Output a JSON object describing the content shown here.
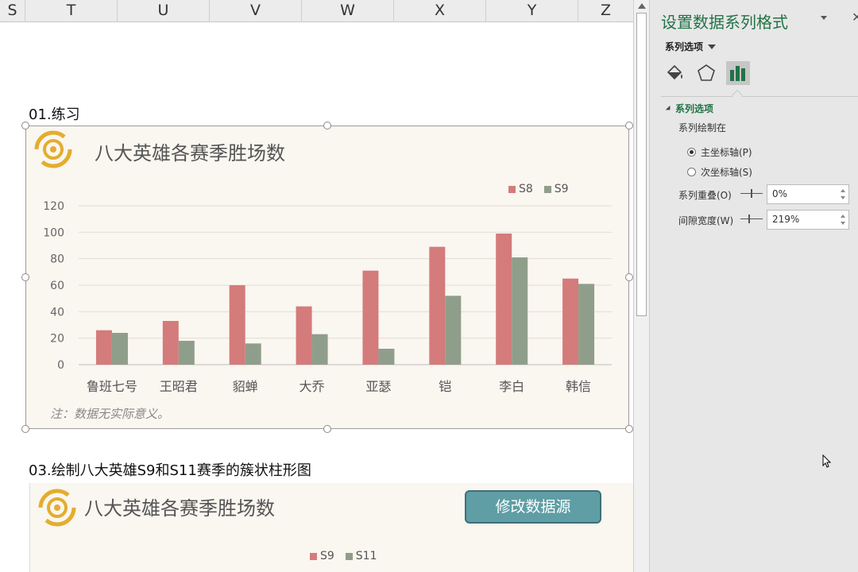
{
  "columns": [
    "S",
    "T",
    "U",
    "V",
    "W",
    "X",
    "Y",
    "Z"
  ],
  "section1_title": "01.练习",
  "section3_title": "03.绘制八大英雄S9和S11赛季的簇状柱形图",
  "chart1": {
    "title": "八大英雄各赛季胜场数",
    "note": "注：数据无实际意义。"
  },
  "chart2": {
    "title": "八大英雄各赛季胜场数",
    "button_label": "修改数据源",
    "legend": [
      "S9",
      "S11"
    ]
  },
  "chart_data": {
    "type": "bar",
    "title": "八大英雄各赛季胜场数",
    "categories": [
      "鲁班七号",
      "王昭君",
      "貂蝉",
      "大乔",
      "亚瑟",
      "铠",
      "李白",
      "韩信"
    ],
    "series": [
      {
        "name": "S8",
        "values": [
          26,
          33,
          60,
          44,
          71,
          89,
          99,
          65
        ],
        "color": "#d47b7b"
      },
      {
        "name": "S9",
        "values": [
          24,
          18,
          16,
          23,
          12,
          52,
          81,
          61
        ],
        "color": "#8f9e8a"
      }
    ],
    "yticks": [
      "0",
      "20",
      "40",
      "60",
      "80",
      "100",
      "120"
    ],
    "ylim": [
      0,
      120
    ],
    "grid": true,
    "legend_position": "top-right",
    "xlabel": "",
    "ylabel": ""
  },
  "pane": {
    "title": "设置数据系列格式",
    "options_dropdown": "系列选项",
    "section_label": "系列选项",
    "plot_on_label": "系列绘制在",
    "radio_primary": "主坐标轴(P)",
    "radio_secondary": "次坐标轴(S)",
    "overlap_label": "系列重叠(O)",
    "overlap_value": "0%",
    "gap_label": "间隙宽度(W)",
    "gap_value": "219%",
    "icons": [
      "fill-line-icon",
      "effects-icon",
      "series-options-icon"
    ]
  }
}
